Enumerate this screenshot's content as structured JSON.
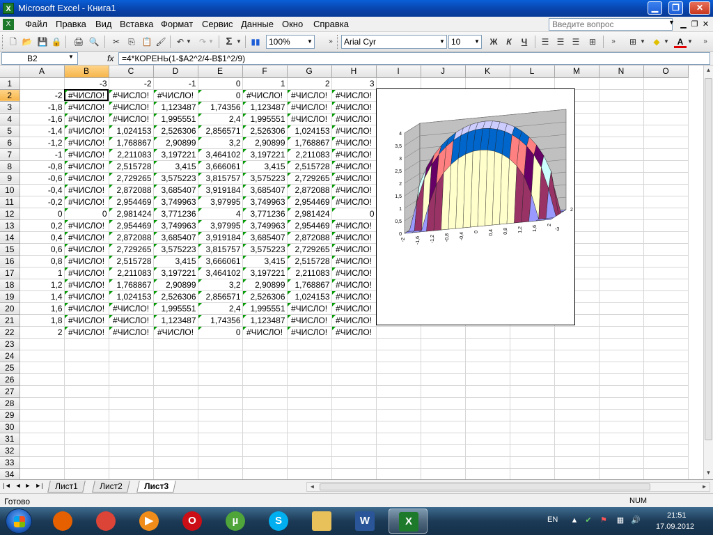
{
  "window": {
    "title": "Microsoft Excel - Книга1",
    "icon": "excel-icon",
    "controls": [
      "minimize-icon",
      "maximize-icon",
      "close-icon"
    ]
  },
  "menu": {
    "items": [
      "Файл",
      "Правка",
      "Вид",
      "Вставка",
      "Формат",
      "Сервис",
      "Данные",
      "Окно",
      "Справка"
    ],
    "help_placeholder": "Введите вопрос"
  },
  "toolbar": {
    "zoom": "100%",
    "font": "Arial Cyr",
    "size": "10",
    "bold": "Ж",
    "italic": "К",
    "underline": "Ч",
    "sum": "Σ"
  },
  "formula_bar": {
    "cell": "B2",
    "fx": "fx",
    "formula": "=4*КОРЕНЬ(1-$A2^2/4-B$1^2/9)"
  },
  "sheet": {
    "columns": [
      "A",
      "B",
      "C",
      "D",
      "E",
      "F",
      "G",
      "H",
      "I",
      "J",
      "K",
      "L",
      "M",
      "N",
      "O"
    ],
    "active_col": "B",
    "active_row": 2,
    "total_rows": 34,
    "rows": [
      [
        "",
        "-3",
        "-2",
        "-1",
        "0",
        "1",
        "2",
        "3"
      ],
      [
        "-2",
        "#ЧИСЛО!",
        "#ЧИСЛО!",
        "#ЧИСЛО!",
        "0",
        "#ЧИСЛО!",
        "#ЧИСЛО!",
        "#ЧИСЛО!"
      ],
      [
        "-1,8",
        "#ЧИСЛО!",
        "#ЧИСЛО!",
        "1,123487",
        "1,74356",
        "1,123487",
        "#ЧИСЛО!",
        "#ЧИСЛО!"
      ],
      [
        "-1,6",
        "#ЧИСЛО!",
        "#ЧИСЛО!",
        "1,995551",
        "2,4",
        "1,995551",
        "#ЧИСЛО!",
        "#ЧИСЛО!"
      ],
      [
        "-1,4",
        "#ЧИСЛО!",
        "1,024153",
        "2,526306",
        "2,856571",
        "2,526306",
        "1,024153",
        "#ЧИСЛО!"
      ],
      [
        "-1,2",
        "#ЧИСЛО!",
        "1,768867",
        "2,90899",
        "3,2",
        "2,90899",
        "1,768867",
        "#ЧИСЛО!"
      ],
      [
        "-1",
        "#ЧИСЛО!",
        "2,211083",
        "3,197221",
        "3,464102",
        "3,197221",
        "2,211083",
        "#ЧИСЛО!"
      ],
      [
        "-0,8",
        "#ЧИСЛО!",
        "2,515728",
        "3,415",
        "3,666061",
        "3,415",
        "2,515728",
        "#ЧИСЛО!"
      ],
      [
        "-0,6",
        "#ЧИСЛО!",
        "2,729265",
        "3,575223",
        "3,815757",
        "3,575223",
        "2,729265",
        "#ЧИСЛО!"
      ],
      [
        "-0,4",
        "#ЧИСЛО!",
        "2,872088",
        "3,685407",
        "3,919184",
        "3,685407",
        "2,872088",
        "#ЧИСЛО!"
      ],
      [
        "-0,2",
        "#ЧИСЛО!",
        "2,954469",
        "3,749963",
        "3,97995",
        "3,749963",
        "2,954469",
        "#ЧИСЛО!"
      ],
      [
        "0",
        "0",
        "2,981424",
        "3,771236",
        "4",
        "3,771236",
        "2,981424",
        "0"
      ],
      [
        "0,2",
        "#ЧИСЛО!",
        "2,954469",
        "3,749963",
        "3,97995",
        "3,749963",
        "2,954469",
        "#ЧИСЛО!"
      ],
      [
        "0,4",
        "#ЧИСЛО!",
        "2,872088",
        "3,685407",
        "3,919184",
        "3,685407",
        "2,872088",
        "#ЧИСЛО!"
      ],
      [
        "0,6",
        "#ЧИСЛО!",
        "2,729265",
        "3,575223",
        "3,815757",
        "3,575223",
        "2,729265",
        "#ЧИСЛО!"
      ],
      [
        "0,8",
        "#ЧИСЛО!",
        "2,515728",
        "3,415",
        "3,666061",
        "3,415",
        "2,515728",
        "#ЧИСЛО!"
      ],
      [
        "1",
        "#ЧИСЛО!",
        "2,211083",
        "3,197221",
        "3,464102",
        "3,197221",
        "2,211083",
        "#ЧИСЛО!"
      ],
      [
        "1,2",
        "#ЧИСЛО!",
        "1,768867",
        "2,90899",
        "3,2",
        "2,90899",
        "1,768867",
        "#ЧИСЛО!"
      ],
      [
        "1,4",
        "#ЧИСЛО!",
        "1,024153",
        "2,526306",
        "2,856571",
        "2,526306",
        "1,024153",
        "#ЧИСЛО!"
      ],
      [
        "1,6",
        "#ЧИСЛО!",
        "#ЧИСЛО!",
        "1,995551",
        "2,4",
        "1,995551",
        "#ЧИСЛО!",
        "#ЧИСЛО!"
      ],
      [
        "1,8",
        "#ЧИСЛО!",
        "#ЧИСЛО!",
        "1,123487",
        "1,74356",
        "1,123487",
        "#ЧИСЛО!",
        "#ЧИСЛО!"
      ],
      [
        "2",
        "#ЧИСЛО!",
        "#ЧИСЛО!",
        "#ЧИСЛО!",
        "0",
        "#ЧИСЛО!",
        "#ЧИСЛО!",
        "#ЧИСЛО!"
      ]
    ]
  },
  "chart": {
    "z_ticks": [
      "0",
      "0,5",
      "1",
      "1,5",
      "2",
      "2,5",
      "3",
      "3,5",
      "4"
    ],
    "x_ticks": [
      "-2",
      "-1,6",
      "-1,2",
      "-0,8",
      "-0,4",
      "0",
      "0,4",
      "0,8",
      "1,2",
      "1,6",
      "2"
    ],
    "y_ticks": [
      "2",
      "-3"
    ],
    "band_colors": [
      "#9999ff",
      "#993366",
      "#ffffcc",
      "#ccffff",
      "#660066",
      "#ff8080",
      "#0066cc",
      "#ccccff"
    ],
    "wall_color": "#c0c0c0"
  },
  "tabs": {
    "sheets": [
      "Лист1",
      "Лист2",
      "Лист3"
    ],
    "active": "Лист3"
  },
  "status": {
    "text": "Готово",
    "num": "NUM"
  },
  "taskbar": {
    "apps": [
      {
        "name": "firefox",
        "letter": "",
        "color": "#e66000"
      },
      {
        "name": "chrome",
        "letter": "",
        "color": "#db4437"
      },
      {
        "name": "media-player",
        "letter": "▶",
        "color": "#f08c1a"
      },
      {
        "name": "opera",
        "letter": "O",
        "color": "#cc0f16"
      },
      {
        "name": "utorrent",
        "letter": "µ",
        "color": "#4fa43a"
      },
      {
        "name": "skype",
        "letter": "S",
        "color": "#00aff0"
      },
      {
        "name": "explorer",
        "letter": "",
        "color": "#e8c15a"
      },
      {
        "name": "word",
        "letter": "W",
        "color": "#2a5699"
      },
      {
        "name": "excel",
        "letter": "X",
        "color": "#1d7a2a"
      }
    ],
    "lang": "EN",
    "time": "21:51",
    "date": "17.09.2012"
  }
}
